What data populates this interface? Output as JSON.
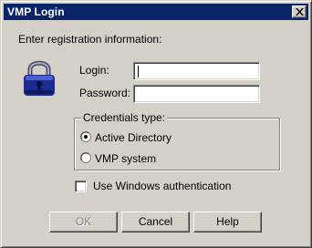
{
  "window": {
    "title": "VMP Login",
    "close_icon": "close-icon"
  },
  "form": {
    "instruction": "Enter registration information:",
    "login_label": "Login:",
    "login_value": "",
    "password_label": "Password:",
    "password_value": ""
  },
  "credentials": {
    "group_label": "Credentials type:",
    "options": [
      {
        "label": "Active Directory",
        "selected": true
      },
      {
        "label": "VMP system",
        "selected": false
      }
    ]
  },
  "windows_auth": {
    "label": "Use Windows authentication",
    "checked": false
  },
  "buttons": {
    "ok": "OK",
    "cancel": "Cancel",
    "help": "Help"
  },
  "colors": {
    "title_bar": "#0a246a",
    "face": "#d4d0c8",
    "lock_body": "#1b2b8f"
  },
  "icons": {
    "lock": "lock-icon"
  }
}
